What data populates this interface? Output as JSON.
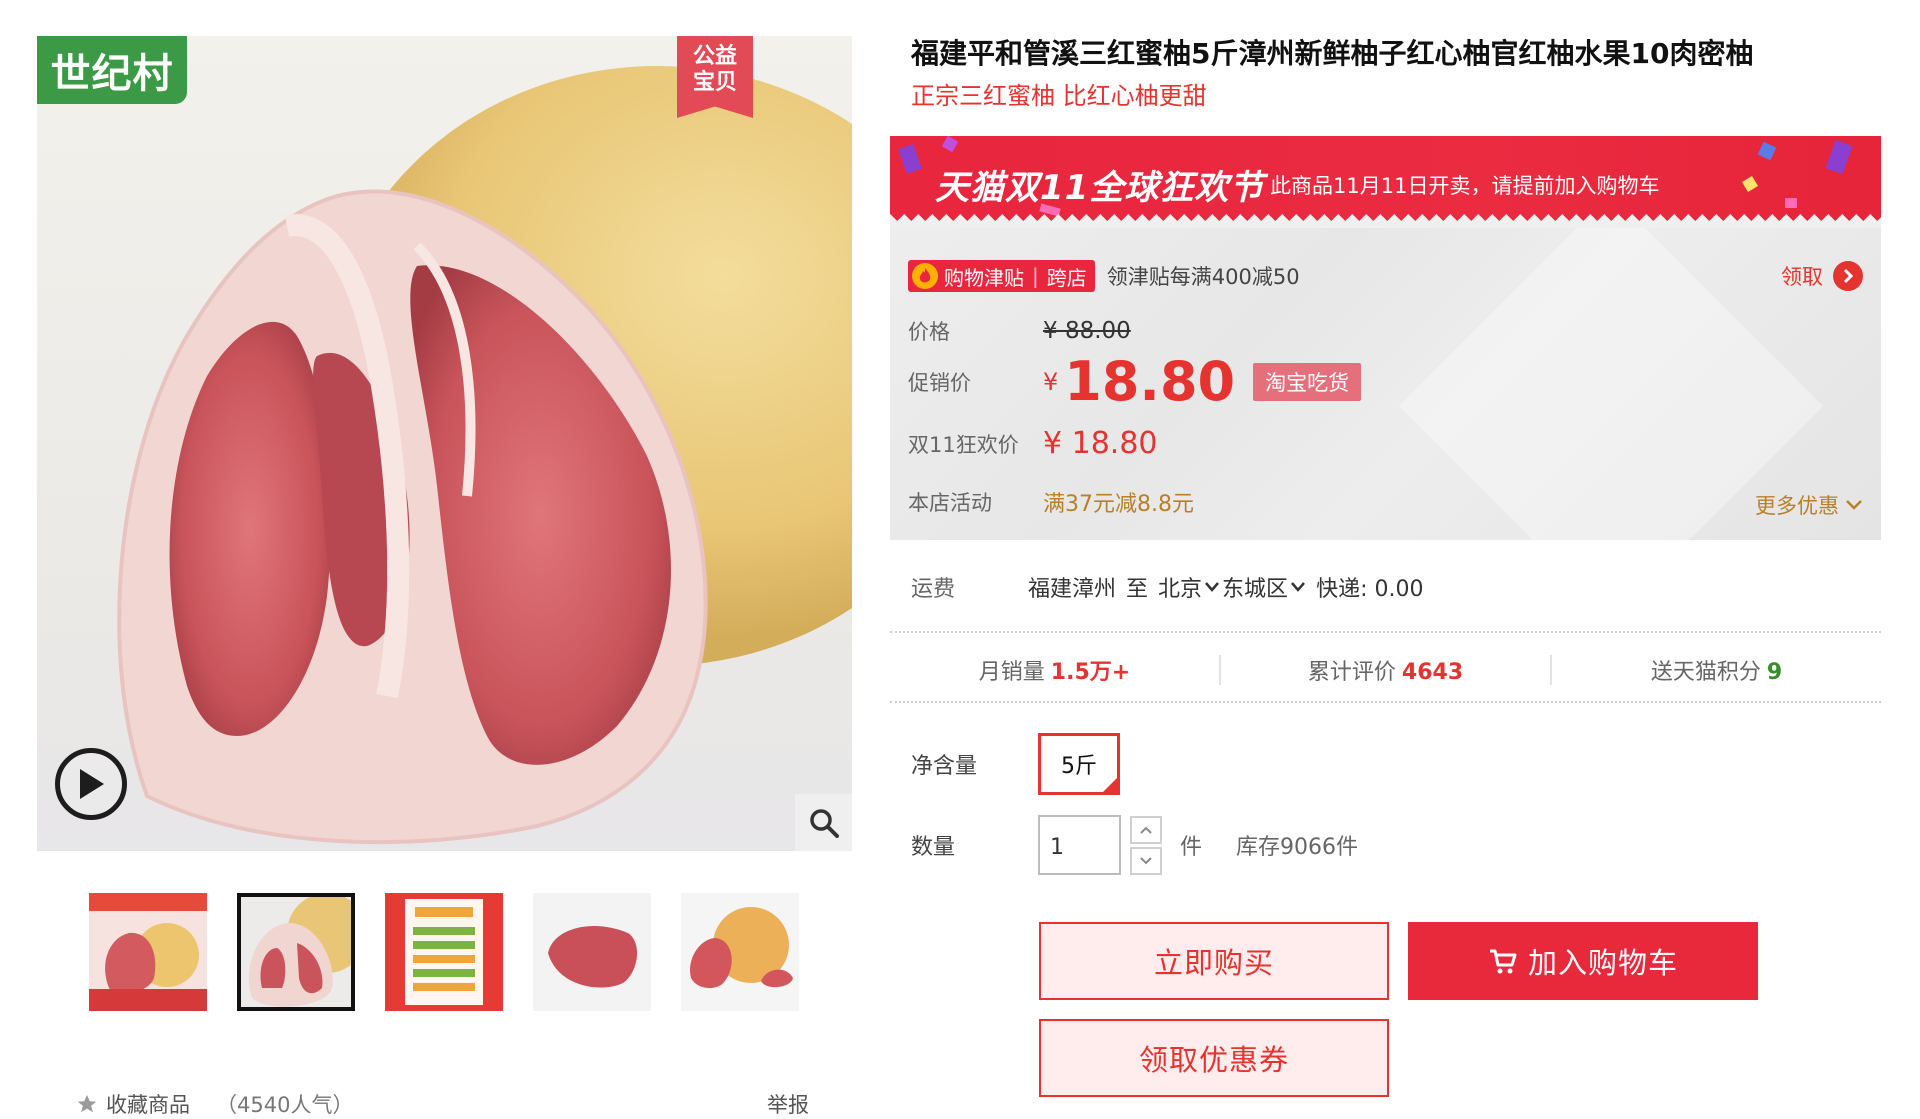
{
  "gallery": {
    "brand_badge": "世纪村",
    "charity_badge_line1": "公益",
    "charity_badge_line2": "宝贝",
    "thumbnails": [
      {
        "icon": "thumbnail-poster"
      },
      {
        "icon": "thumbnail-pomelo-cut"
      },
      {
        "icon": "thumbnail-info-poster"
      },
      {
        "icon": "thumbnail-pomelo-segment"
      },
      {
        "icon": "thumbnail-pomelo-whole"
      }
    ],
    "favorite_label": "收藏商品",
    "favorite_count": "（4540人气）",
    "report_label": "举报"
  },
  "product": {
    "title": "福建平和管溪三红蜜柚5斤漳州新鲜柚子红心柚官红柚水果10肉密柚",
    "subtitle": "正宗三红蜜柚 比红心柚更甜"
  },
  "promo": {
    "double11_title": "天猫双11全球狂欢节",
    "double11_note": "此商品11月11日开卖，请提前加入购物车",
    "coupon_tag": "购物津贴",
    "coupon_tag2": "跨店",
    "coupon_desc": "领津贴每满400减50",
    "claim_label": "领取",
    "price_label": "价格",
    "original_price": "¥ 88.00",
    "promo_label": "促销价",
    "yen": "¥",
    "promo_price": "18.80",
    "promo_badge": "淘宝吃货",
    "d11_label": "双11狂欢价",
    "d11_price": "¥ 18.80",
    "shop_label": "本店活动",
    "shop_activity": "满37元减8.8元",
    "more_offers": "更多优惠"
  },
  "shipping": {
    "label": "运费",
    "origin": "福建漳州",
    "to": "至",
    "city": "北京",
    "district": "东城区",
    "express": "快递: 0.00"
  },
  "stats": {
    "monthly_label": "月销量",
    "monthly_value": "1.5万+",
    "reviews_label": "累计评价",
    "reviews_value": "4643",
    "points_label": "送天猫积分",
    "points_value": "9"
  },
  "options": {
    "weight_label": "净含量",
    "weight_value": "5斤",
    "qty_label": "数量",
    "qty_value": "1",
    "qty_unit": "件",
    "stock": "库存9066件"
  },
  "actions": {
    "buy_now": "立即购买",
    "add_cart": "加入购物车",
    "coupon": "领取优惠券"
  },
  "colors": {
    "accent": "#e5332f",
    "brand_green": "#3c9a46",
    "activity": "#b8802a"
  }
}
